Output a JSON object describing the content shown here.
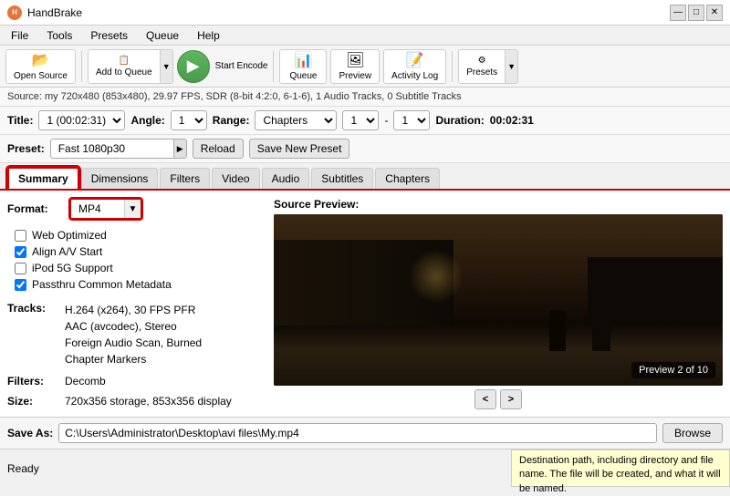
{
  "app": {
    "title": "HandBrake",
    "logo_text": "H"
  },
  "titlebar": {
    "title": "HandBrake",
    "controls": [
      "—",
      "□",
      "✕"
    ]
  },
  "menubar": {
    "items": [
      "File",
      "Tools",
      "Presets",
      "Queue",
      "Help"
    ]
  },
  "toolbar": {
    "open_source": "Open Source",
    "add_to_queue": "Add to Queue",
    "start_encode": "Start Encode",
    "queue": "Queue",
    "preview": "Preview",
    "activity_log": "Activity Log",
    "presets": "Presets"
  },
  "sourcebar": {
    "text": "Source: my  720x480 (853x480), 29.97 FPS, SDR (8-bit 4:2:0, 6-1-6), 1 Audio Tracks, 0 Subtitle Tracks"
  },
  "title_row": {
    "title_label": "Title:",
    "title_value": "1 (00:02:31)",
    "angle_label": "Angle:",
    "angle_value": "1",
    "range_label": "Range:",
    "range_type": "Chapters",
    "range_start": "1",
    "range_end": "1",
    "duration_label": "Duration:",
    "duration_value": "00:02:31"
  },
  "preset_row": {
    "label": "Preset:",
    "value": "Fast 1080p30",
    "reload_btn": "Reload",
    "save_btn": "Save New Preset"
  },
  "tabs": {
    "items": [
      "Summary",
      "Dimensions",
      "Filters",
      "Video",
      "Audio",
      "Subtitles",
      "Chapters"
    ],
    "active": 0
  },
  "summary": {
    "format_label": "Format:",
    "format_value": "MP4",
    "options": [
      {
        "label": "Web Optimized",
        "checked": false
      },
      {
        "label": "Align A/V Start",
        "checked": true
      },
      {
        "label": "iPod 5G Support",
        "checked": false
      },
      {
        "label": "Passthru Common Metadata",
        "checked": true
      }
    ],
    "tracks_label": "Tracks:",
    "tracks_lines": [
      "H.264 (x264), 30 FPS PFR",
      "AAC (avcodec), Stereo",
      "Foreign Audio Scan, Burned",
      "Chapter Markers"
    ],
    "filters_label": "Filters:",
    "filters_value": "Decomb",
    "size_label": "Size:",
    "size_value": "720x356 storage, 853x356 display"
  },
  "preview": {
    "label": "Source Preview:",
    "nav_label": "Preview 2 of 10",
    "prev_btn": "<",
    "next_btn": ">"
  },
  "saveas": {
    "label": "Save As:",
    "path": "C:\\Users\\Administrator\\Desktop\\avi files\\My.mp4",
    "browse_btn": "Browse"
  },
  "statusbar": {
    "status": "Ready",
    "tooltip": "Destination path, including directory and file name. The file will be created, and what it will be named."
  }
}
